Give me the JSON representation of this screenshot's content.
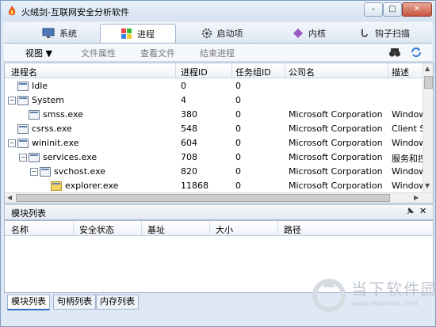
{
  "window": {
    "title": "火绒剑-互联网安全分析软件",
    "controls": {
      "minimize": "–",
      "maximize": "□",
      "close": "✕"
    }
  },
  "tabs": [
    {
      "label": "系统",
      "icon": "monitor-icon"
    },
    {
      "label": "进程",
      "icon": "windows-flag-icon",
      "active": true
    },
    {
      "label": "启动项",
      "icon": "gear-icon"
    },
    {
      "label": "内核",
      "icon": "kernel-icon"
    },
    {
      "label": "钩子扫描",
      "icon": "hook-icon"
    }
  ],
  "toolbar": {
    "view": "视图 ▼",
    "file_props": "文件属性",
    "view_file": "查看文件",
    "end_process": "结束进程",
    "search_icon": "binoculars-icon",
    "refresh_icon": "refresh-icon"
  },
  "process_table": {
    "columns": [
      "进程名",
      "进程ID",
      "任务组ID",
      "公司名",
      "描述"
    ],
    "rows": [
      {
        "name": "Idle",
        "pid": "0",
        "gid": "0",
        "company": "",
        "desc": "",
        "level": 0,
        "expander": ""
      },
      {
        "name": "System",
        "pid": "4",
        "gid": "0",
        "company": "",
        "desc": "",
        "level": 0,
        "expander": "−"
      },
      {
        "name": "smss.exe",
        "pid": "380",
        "gid": "0",
        "company": "Microsoft Corporation",
        "desc": "Window",
        "level": 1,
        "expander": ""
      },
      {
        "name": "csrss.exe",
        "pid": "548",
        "gid": "0",
        "company": "Microsoft Corporation",
        "desc": "Client S",
        "level": 0,
        "expander": ""
      },
      {
        "name": "wininit.exe",
        "pid": "604",
        "gid": "0",
        "company": "Microsoft Corporation",
        "desc": "Window",
        "level": 0,
        "expander": "−"
      },
      {
        "name": "services.exe",
        "pid": "708",
        "gid": "0",
        "company": "Microsoft Corporation",
        "desc": "服务和控",
        "level": 1,
        "expander": "−"
      },
      {
        "name": "svchost.exe",
        "pid": "820",
        "gid": "0",
        "company": "Microsoft Corporation",
        "desc": "Window",
        "level": 2,
        "expander": "−"
      },
      {
        "name": "explorer.exe",
        "pid": "11868",
        "gid": "0",
        "company": "Microsoft Corporation",
        "desc": "Window",
        "level": 3,
        "expander": ""
      }
    ]
  },
  "module_panel": {
    "title": "模块列表",
    "columns": [
      "名称",
      "安全状态",
      "基址",
      "大小",
      "路径"
    ]
  },
  "bottom_tabs": [
    "模块列表",
    "句柄列表",
    "内存列表"
  ],
  "watermark": {
    "text": "当下软件园",
    "url": "www.downxia.com"
  }
}
